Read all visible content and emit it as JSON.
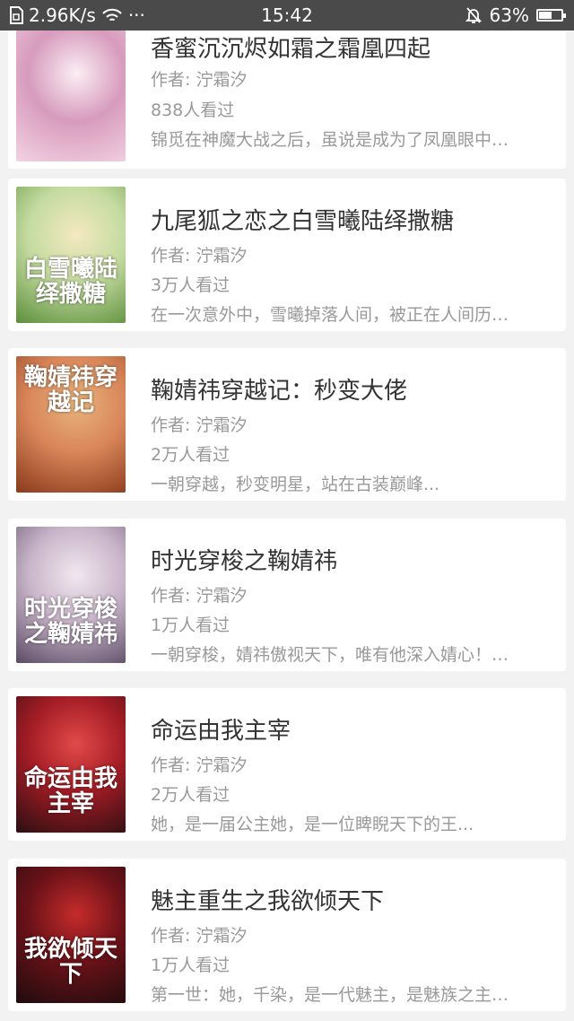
{
  "status_bar": {
    "speed": "2.96K/s",
    "dots": "···",
    "time": "15:42",
    "battery": "63%",
    "battery_level": 0.63
  },
  "books": [
    {
      "title": "香蜜沉沉烬如霜之霜凰四起",
      "author": "作者: 泞霜汐",
      "views": "838人看过",
      "desc": "锦觅在神魔大战之后，虽说是成为了凤凰眼中…",
      "cover_colors": [
        "#f3d3e2",
        "#d79bbd",
        "#fbeef4"
      ]
    },
    {
      "title": "九尾狐之恋之白雪曦陆绎撒糖",
      "author": "作者: 泞霜汐",
      "views": "3万人看过",
      "desc": "在一次意外中，雪曦掉落人间，被正在人间历…",
      "cover_text": "白雪曦陆绎撒糖",
      "cover_colors": [
        "#5b8f3a",
        "#c4dba0",
        "#f3e9c0"
      ]
    },
    {
      "title": "鞠婧祎穿越记：秒变大佬",
      "author": "作者: 泞霜汐",
      "views": "2万人看过",
      "desc": "一朝穿越，秒变明星，站在古装巅峰...",
      "cover_text": "鞠婧祎穿越记",
      "cover_colors": [
        "#8a3a1a",
        "#d9865a",
        "#e8b47c"
      ]
    },
    {
      "title": "时光穿梭之鞠婧祎",
      "author": "作者: 泞霜汐",
      "views": "1万人看过",
      "desc": "一朝穿梭，婧祎傲视天下，唯有他深入婧心！…",
      "cover_text": "时光穿梭之鞠婧祎",
      "cover_colors": [
        "#5a4a63",
        "#c8b4c9",
        "#f1e7ee"
      ]
    },
    {
      "title": "命运由我主宰",
      "author": "作者: 泞霜汐",
      "views": "2万人看过",
      "desc": "她，是一届公主她，是一位睥睨天下的王...",
      "cover_text": "命运由我主宰",
      "cover_colors": [
        "#2a0f12",
        "#a31c24",
        "#e24a4a"
      ]
    },
    {
      "title": "魅主重生之我欲倾天下",
      "author": "作者: 泞霜汐",
      "views": "1万人看过",
      "desc": "第一世：她，千染，是一代魅主，是魅族之主…",
      "cover_text": "我欲倾天下",
      "cover_colors": [
        "#1e0c0e",
        "#6a1218",
        "#c62b2b"
      ]
    }
  ]
}
